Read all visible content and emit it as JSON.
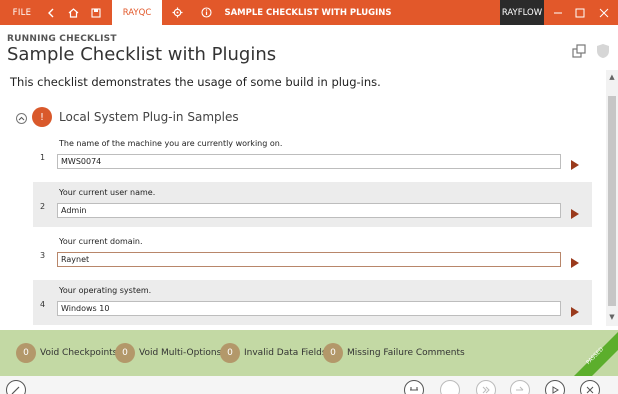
{
  "titlebar": {
    "file_label": "FILE",
    "tab_label": "RAYQC",
    "window_title": "SAMPLE CHECKLIST WITH PLUGINS",
    "rayflow_label": "RAYFLOW",
    "accent_color": "#e2582a"
  },
  "header": {
    "running_label": "RUNNING CHECKLIST",
    "title": "Sample Checklist with Plugins",
    "description": "This checklist demonstrates the usage of some build in plug-ins."
  },
  "section": {
    "badge": "!",
    "title": "Local System Plug-in Samples"
  },
  "items": [
    {
      "number": "1",
      "label": "The name of the machine you are currently working on.",
      "value": "MWS0074"
    },
    {
      "number": "2",
      "label": "Your current user name.",
      "value": "Admin"
    },
    {
      "number": "3",
      "label": "Your current domain.",
      "value": "Raynet"
    },
    {
      "number": "4",
      "label": "Your operating system.",
      "value": "Windows 10"
    }
  ],
  "status": {
    "stats": [
      {
        "count": "0",
        "label": "Void Checkpoints"
      },
      {
        "count": "0",
        "label": "Void Multi-Options"
      },
      {
        "count": "0",
        "label": "Invalid Data Fields"
      },
      {
        "count": "0",
        "label": "Missing Failure Comments"
      }
    ],
    "ribbon_label": "PASSED",
    "ribbon_color": "#5cae2c",
    "bar_color": "#c3d9a4"
  }
}
